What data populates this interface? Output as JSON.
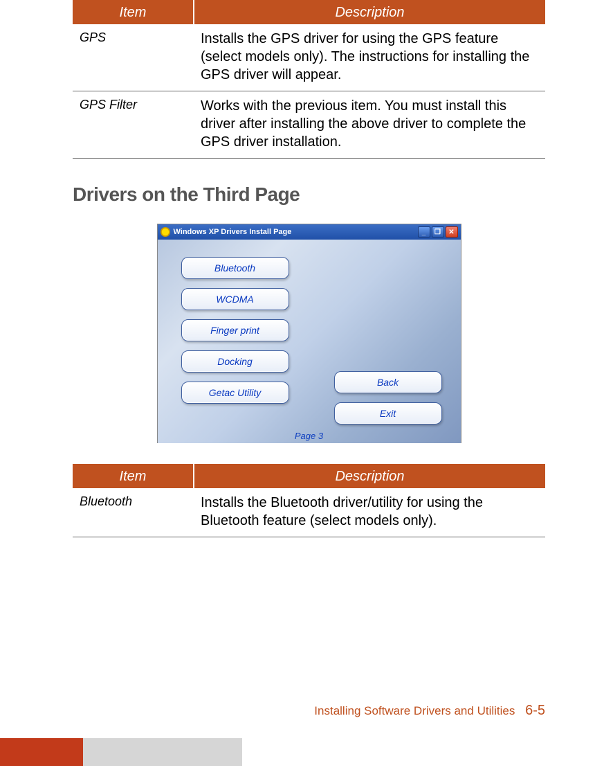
{
  "table1": {
    "head": {
      "item": "Item",
      "desc": "Description"
    },
    "rows": [
      {
        "item": "GPS",
        "desc": "Installs the GPS driver for using the GPS feature (select models only). The instructions for installing the GPS driver will appear."
      },
      {
        "item": "GPS Filter",
        "desc": "Works with the previous item. You must install this driver after installing the above driver to complete the GPS driver installation."
      }
    ]
  },
  "heading": "Drivers on the Third Page",
  "screenshot": {
    "title": "Windows XP Drivers Install Page",
    "buttons_left": [
      "Bluetooth",
      "WCDMA",
      "Finger print",
      "Docking",
      "Getac Utility"
    ],
    "buttons_right": [
      "Back",
      "Exit"
    ],
    "page_label": "Page 3",
    "win_min": "_",
    "win_max": "❐",
    "win_close": "✕"
  },
  "table2": {
    "head": {
      "item": "Item",
      "desc": "Description"
    },
    "rows": [
      {
        "item": "Bluetooth",
        "desc": "Installs the Bluetooth driver/utility for using the Bluetooth feature (select models only)."
      }
    ]
  },
  "footer": {
    "section": "Installing Software Drivers and Utilities",
    "page": "6-5"
  }
}
